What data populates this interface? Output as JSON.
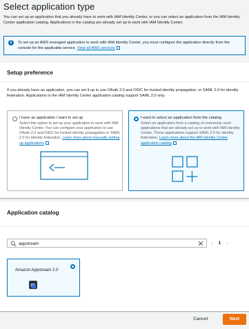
{
  "page": {
    "title": "Select application type",
    "intro": "You can set up an application that you already have to work with IAM Identity Center, or you can select an application from the IAM Identity Center application catalog. Applications in the catalog are already set up to work with IAM Identity Center."
  },
  "info": {
    "text": "To set up an AWS managed application to work with IAM Identity Center, you must configure the application directly from the console for the applicable service.",
    "link": "View all AWS services"
  },
  "setup": {
    "title": "Setup preference",
    "description": "If you already have an application, you can set it up to use OAuth 2.0 and OIDC for trusted identity propagation, or SAML 2.0 for identity federation. Applications in the IAM Identity Center application catalog support SAML 2.0 only.",
    "options": [
      {
        "label": "I have an application I want to set up",
        "description": "Select this option to set up your application to work with IAM Identity Center. You can configure your application to use OAuth 2.0 and OIDC for trusted identity propagation or SAML 2.0 for identity federation.",
        "link": "Learn more about manually setting up applications",
        "selected": false
      },
      {
        "label": "I want to select an application from the catalog",
        "description": "Select an application from a catalog of commonly used applications that are already set up to work with IAM Identity Center. These applications support SAML 2.0 for identity federation.",
        "link": "Learn more about the IAM Identity Center application catalog",
        "selected": true
      }
    ]
  },
  "catalog": {
    "title": "Application catalog",
    "search_value": "appstream",
    "page": "1",
    "apps": [
      {
        "name": "Amazon Appstream 2.0",
        "selected": true
      }
    ]
  },
  "footer": {
    "cancel": "Cancel",
    "next": "Next"
  },
  "colors": {
    "accent": "#0073bb",
    "primary_button": "#ec7211",
    "info_bg": "#f1faff"
  }
}
